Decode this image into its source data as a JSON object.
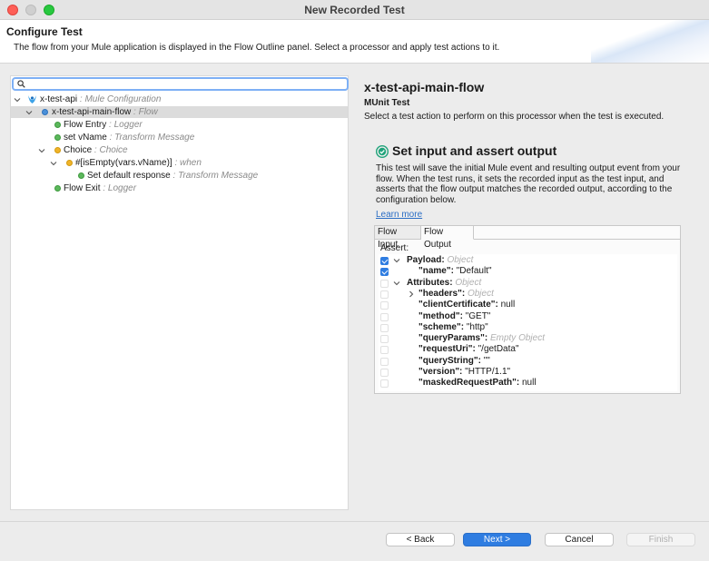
{
  "window": {
    "title": "New Recorded Test"
  },
  "header": {
    "title": "Configure Test",
    "description": "The flow from your Mule application is displayed in the Flow Outline panel. Select a processor and apply test actions to it."
  },
  "search": {
    "placeholder": "",
    "value": ""
  },
  "tree": [
    {
      "name": "x-test-api",
      "type": ": Mule Configuration"
    },
    {
      "name": "x-test-api-main-flow",
      "type": ": Flow"
    },
    {
      "name": "Flow Entry",
      "type": ": Logger"
    },
    {
      "name": "set vName",
      "type": ": Transform Message"
    },
    {
      "name": "Choice",
      "type": ": Choice"
    },
    {
      "name": "#[isEmpty(vars.vName)]",
      "type": ": when"
    },
    {
      "name": "Set default response",
      "type": ": Transform Message"
    },
    {
      "name": "Flow Exit",
      "type": ": Logger"
    }
  ],
  "detail": {
    "title": "x-test-api-main-flow",
    "subtitle": "MUnit Test",
    "description": "Select a test action to perform on this processor when the test is executed."
  },
  "action": {
    "title": "Set input and assert output",
    "description": "This test will save the initial Mule event and resulting output event from your flow. When the test runs, it sets the recorded input as the test input, and asserts that the flow output matches the recorded output, according to the configuration below.",
    "learn_more": "Learn more"
  },
  "tabs": [
    {
      "label": "Flow Input"
    },
    {
      "label": "Flow Output"
    }
  ],
  "assert": {
    "label": "Assert:",
    "rows": [
      {
        "key": "Payload:",
        "value": "Object"
      },
      {
        "key": "\"name\":",
        "value": "\"Default\""
      },
      {
        "key": "Attributes:",
        "value": "Object"
      },
      {
        "key": "\"headers\":",
        "value": "Object"
      },
      {
        "key": "\"clientCertificate\":",
        "value": "null"
      },
      {
        "key": "\"method\":",
        "value": "\"GET\""
      },
      {
        "key": "\"scheme\":",
        "value": "\"http\""
      },
      {
        "key": "\"queryParams\":",
        "value": "Empty Object"
      },
      {
        "key": "\"requestUri\":",
        "value": "\"/getData\""
      },
      {
        "key": "\"queryString\":",
        "value": "\"\""
      },
      {
        "key": "\"version\":",
        "value": "\"HTTP/1.1\""
      },
      {
        "key": "\"maskedRequestPath\":",
        "value": "null"
      }
    ]
  },
  "buttons": {
    "back": "< Back",
    "next": "Next >",
    "cancel": "Cancel",
    "finish": "Finish"
  },
  "colors": {
    "accent": "#2f7de1",
    "processor_dot": "#5cb85c",
    "flow_dot": "#4a90d9",
    "router_dot": "#f0b429",
    "link": "#2b6ec5"
  }
}
